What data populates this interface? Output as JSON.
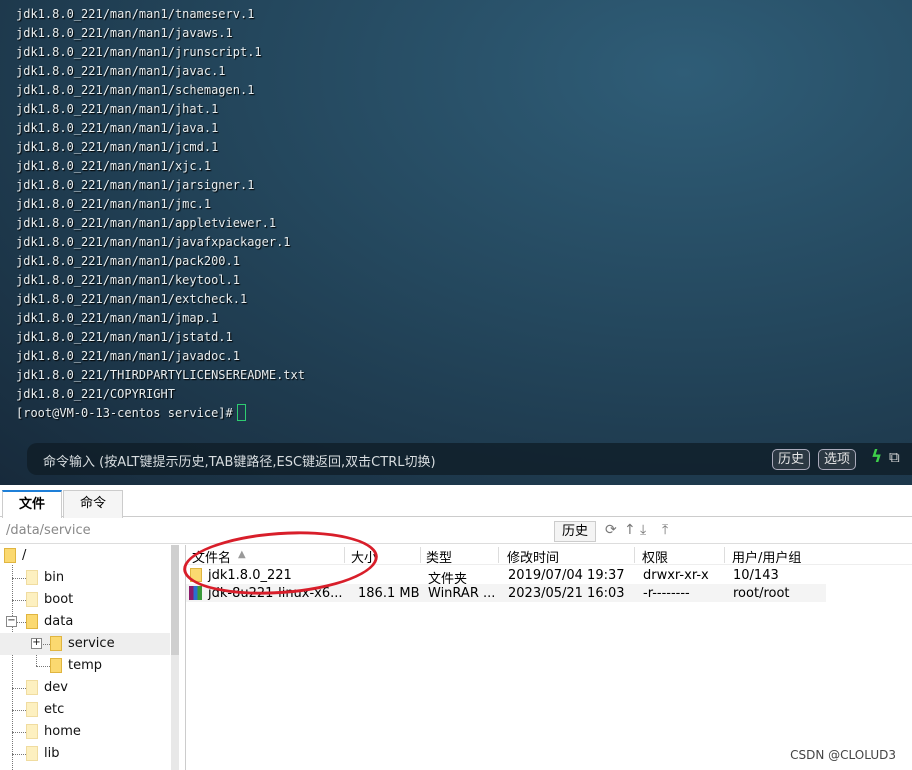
{
  "terminal": {
    "lines": [
      "jdk1.8.0_221/man/man1/tnameserv.1",
      "jdk1.8.0_221/man/man1/javaws.1",
      "jdk1.8.0_221/man/man1/jrunscript.1",
      "jdk1.8.0_221/man/man1/javac.1",
      "jdk1.8.0_221/man/man1/schemagen.1",
      "jdk1.8.0_221/man/man1/jhat.1",
      "jdk1.8.0_221/man/man1/java.1",
      "jdk1.8.0_221/man/man1/jcmd.1",
      "jdk1.8.0_221/man/man1/xjc.1",
      "jdk1.8.0_221/man/man1/jarsigner.1",
      "jdk1.8.0_221/man/man1/jmc.1",
      "jdk1.8.0_221/man/man1/appletviewer.1",
      "jdk1.8.0_221/man/man1/javafxpackager.1",
      "jdk1.8.0_221/man/man1/pack200.1",
      "jdk1.8.0_221/man/man1/keytool.1",
      "jdk1.8.0_221/man/man1/extcheck.1",
      "jdk1.8.0_221/man/man1/jmap.1",
      "jdk1.8.0_221/man/man1/jstatd.1",
      "jdk1.8.0_221/man/man1/javadoc.1",
      "jdk1.8.0_221/THIRDPARTYLICENSEREADME.txt",
      "jdk1.8.0_221/COPYRIGHT"
    ],
    "prompt": "[root@VM-0-13-centos service]#",
    "cmd_hint": "命令输入 (按ALT键提示历史,TAB键路径,ESC键返回,双击CTRL切换)",
    "history_label": "历史",
    "options_label": "选项"
  },
  "tabs": [
    {
      "label": "文件",
      "active": true
    },
    {
      "label": "命令",
      "active": false
    }
  ],
  "pathbar": {
    "path": "/data/service",
    "history_label": "历史",
    "icons": [
      "refresh-icon",
      "up-icon",
      "download-icon",
      "upload-icon"
    ]
  },
  "tree": [
    {
      "label": "/"
    },
    {
      "label": "bin"
    },
    {
      "label": "boot"
    },
    {
      "label": "data"
    },
    {
      "label": "service",
      "selected": true
    },
    {
      "label": "temp"
    },
    {
      "label": "dev"
    },
    {
      "label": "etc"
    },
    {
      "label": "home"
    },
    {
      "label": "lib"
    }
  ],
  "files": {
    "columns": [
      "文件名",
      "大小",
      "类型",
      "修改时间",
      "权限",
      "用户/用户组"
    ],
    "rows": [
      {
        "name": "jdk1.8.0_221",
        "size": "",
        "type": "文件夹",
        "mtime": "2019/07/04 19:37",
        "perm": "drwxr-xr-x",
        "owner": "10/143"
      },
      {
        "name": "jdk-8u221-linux-x6...",
        "size": "186.1 MB",
        "type": "WinRAR ...",
        "mtime": "2023/05/21 16:03",
        "perm": "-r--------",
        "owner": "root/root"
      }
    ]
  },
  "watermark": "CSDN @CLOLUD3",
  "colors": {
    "accent_tab": "#1e7fd8",
    "annotation": "#d81e2a",
    "cursor": "#2ecc71"
  }
}
